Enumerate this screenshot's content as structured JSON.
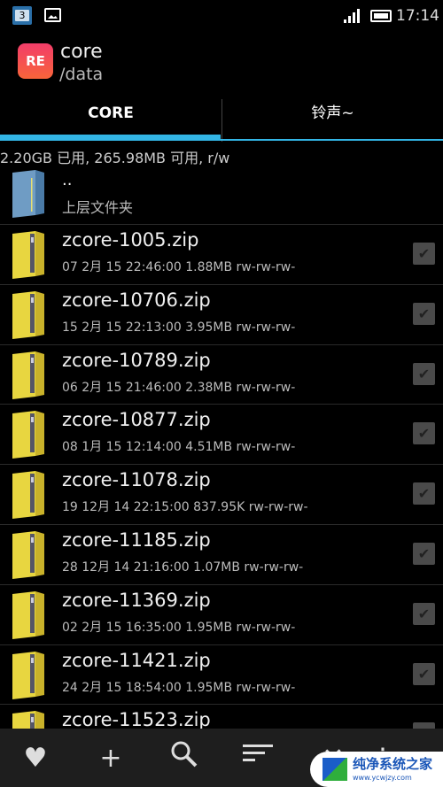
{
  "status_bar": {
    "calendar_day": "3",
    "time": "17:14"
  },
  "header": {
    "app_icon_text": "RE",
    "title": "core",
    "path": "/data"
  },
  "tabs": [
    {
      "label": "CORE",
      "active": true
    },
    {
      "label": "铃声~",
      "active": false
    }
  ],
  "accent_color": "#33b5e5",
  "storage_info": "2.20GB 已用, 265.98MB 可用, r/w",
  "parent": {
    "name": "..",
    "label": "上层文件夹"
  },
  "files": [
    {
      "name": "zcore-1005.zip",
      "meta": "07 2月 15 22:46:00  1.88MB  rw-rw-rw-"
    },
    {
      "name": "zcore-10706.zip",
      "meta": "15 2月 15 22:13:00  3.95MB  rw-rw-rw-"
    },
    {
      "name": "zcore-10789.zip",
      "meta": "06 2月 15 21:46:00  2.38MB  rw-rw-rw-"
    },
    {
      "name": "zcore-10877.zip",
      "meta": "08 1月 15 12:14:00  4.51MB  rw-rw-rw-"
    },
    {
      "name": "zcore-11078.zip",
      "meta": "19 12月 14 22:15:00  837.95K  rw-rw-rw-"
    },
    {
      "name": "zcore-11185.zip",
      "meta": "28 12月 14 21:16:00  1.07MB  rw-rw-rw-"
    },
    {
      "name": "zcore-11369.zip",
      "meta": "02 2月 15 16:35:00  1.95MB  rw-rw-rw-"
    },
    {
      "name": "zcore-11421.zip",
      "meta": "24 2月 15 18:54:00  1.95MB  rw-rw-rw-"
    },
    {
      "name": "zcore-11523.zip",
      "meta": ""
    }
  ],
  "bottom_bar": [
    "heart-icon",
    "plus-icon",
    "search-icon",
    "sort-icon",
    "close-icon",
    "more-icon"
  ],
  "watermark": {
    "title": "纯净系统之家",
    "url": "www.ycwjzy.com"
  }
}
